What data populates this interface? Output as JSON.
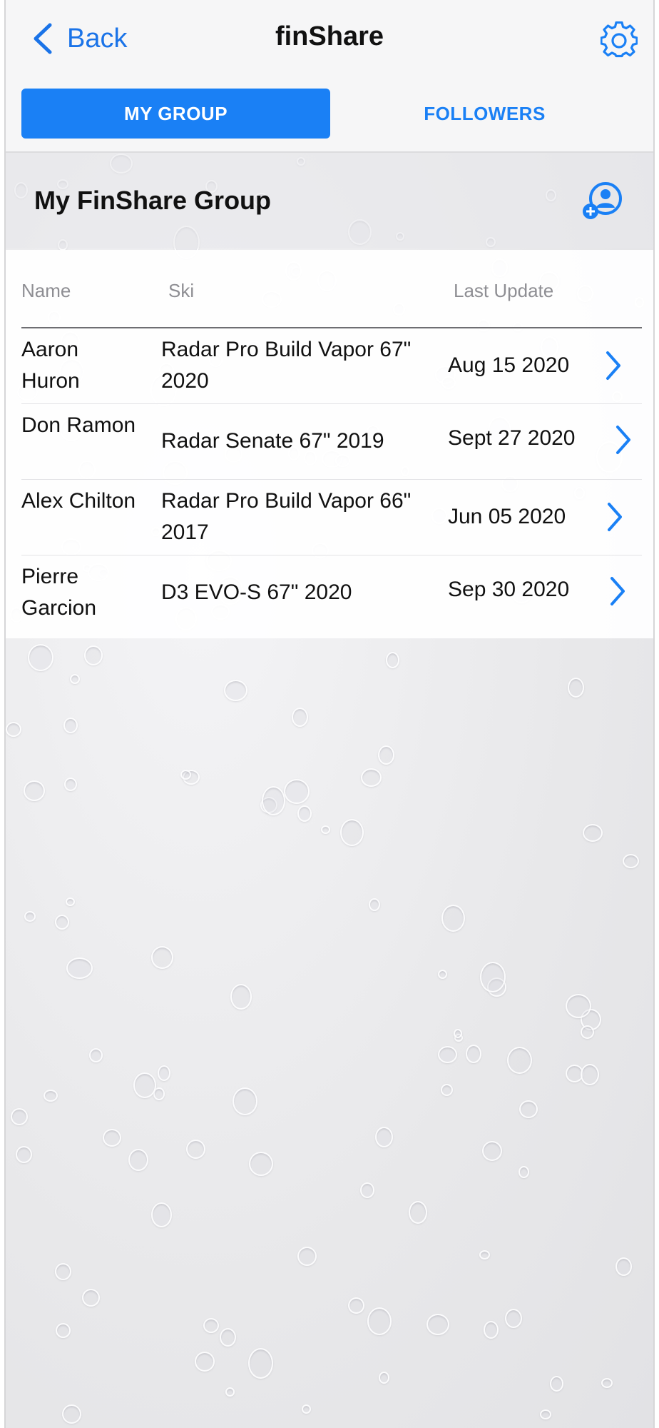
{
  "nav": {
    "back_label": "Back",
    "title": "finShare"
  },
  "tabs": [
    {
      "label": "MY GROUP",
      "active": true
    },
    {
      "label": "FOLLOWERS",
      "active": false
    }
  ],
  "group": {
    "title": "My FinShare Group"
  },
  "table": {
    "headers": {
      "name": "Name",
      "ski": "Ski",
      "last_update": "Last Update"
    },
    "rows": [
      {
        "name": "Aaron Huron",
        "ski": "Radar Pro Build Vapor 67\" 2020",
        "last_update": "Aug 15 2020"
      },
      {
        "name": "Don Ramon",
        "ski": "Radar Senate 67\" 2019",
        "last_update": "Sept 27 2020"
      },
      {
        "name": "Alex Chilton",
        "ski": "Radar Pro Build Vapor 66\" 2017",
        "last_update": "Jun 05 2020"
      },
      {
        "name": "Pierre Garcion",
        "ski": "D3 EVO-S 67\" 2020",
        "last_update": "Sep 30 2020"
      }
    ]
  },
  "icons": {
    "back": "chevron-left-icon",
    "settings": "gear-icon",
    "add_user": "add-user-icon",
    "row_disclosure": "chevron-right-icon"
  },
  "colors": {
    "accent": "#1a80f5",
    "link": "#1a73e8",
    "secondary_text": "#8e8e93"
  }
}
